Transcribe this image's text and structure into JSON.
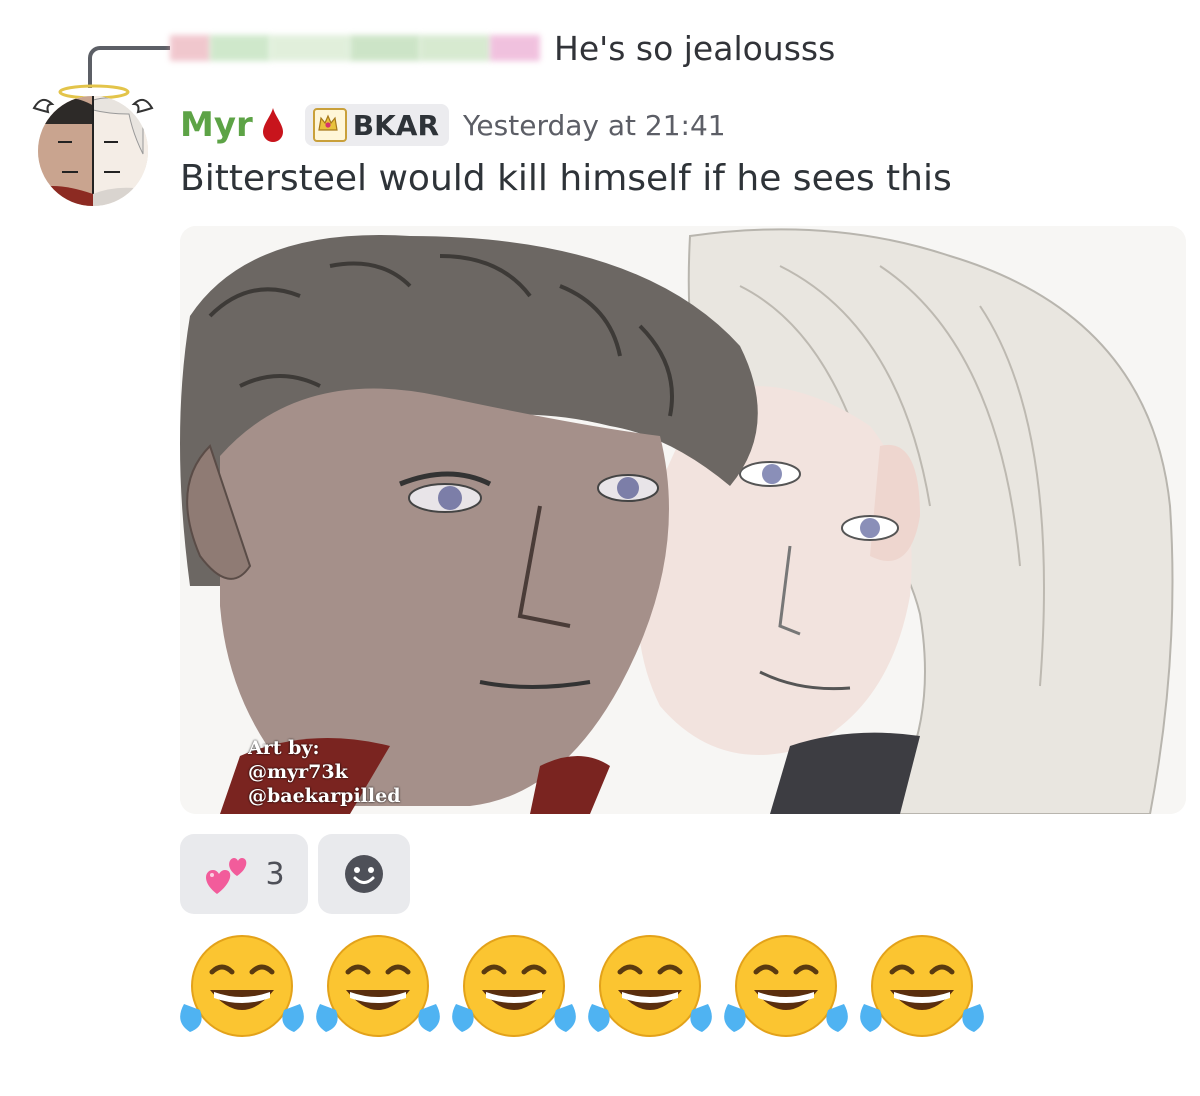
{
  "reply": {
    "text": "He's so jealousss"
  },
  "message": {
    "username": "Myr",
    "username_color": "#5da346",
    "role_tag": "BKAR",
    "timestamp": "Yesterday at 21:41",
    "text": "Bittersteel would kill himself if he sees this"
  },
  "image": {
    "credit_line1": "Art by:",
    "credit_line2": "@myr73k",
    "credit_line3": "@baekarpilled"
  },
  "reactions": [
    {
      "icon": "two-hearts-icon",
      "count": "3"
    }
  ],
  "add_reaction_icon": "smiley-icon",
  "trailing_emojis": [
    "joy-icon",
    "joy-icon",
    "joy-icon",
    "joy-icon",
    "joy-icon",
    "joy-icon"
  ]
}
